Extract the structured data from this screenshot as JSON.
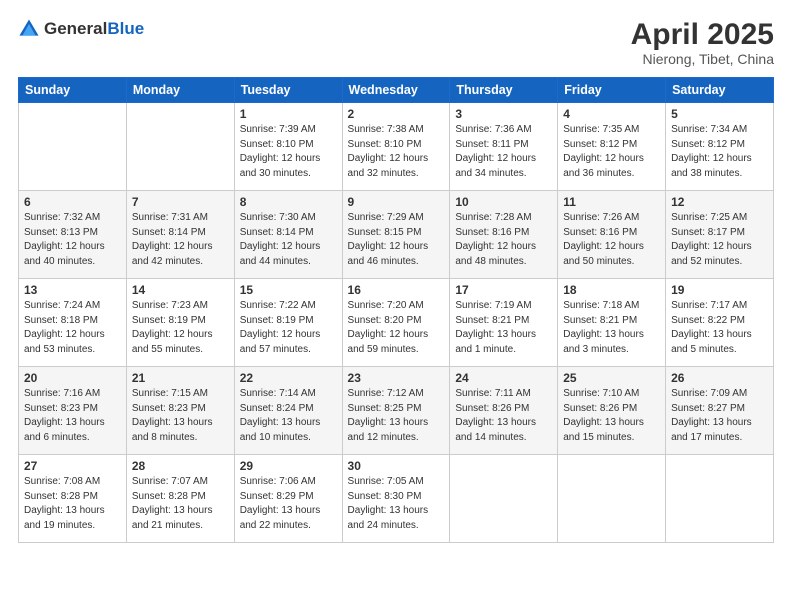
{
  "header": {
    "logo_general": "General",
    "logo_blue": "Blue",
    "month_year": "April 2025",
    "location": "Nierong, Tibet, China"
  },
  "days_of_week": [
    "Sunday",
    "Monday",
    "Tuesday",
    "Wednesday",
    "Thursday",
    "Friday",
    "Saturday"
  ],
  "weeks": [
    [
      {
        "day": "",
        "info": ""
      },
      {
        "day": "",
        "info": ""
      },
      {
        "day": "1",
        "info": "Sunrise: 7:39 AM\nSunset: 8:10 PM\nDaylight: 12 hours and 30 minutes."
      },
      {
        "day": "2",
        "info": "Sunrise: 7:38 AM\nSunset: 8:10 PM\nDaylight: 12 hours and 32 minutes."
      },
      {
        "day": "3",
        "info": "Sunrise: 7:36 AM\nSunset: 8:11 PM\nDaylight: 12 hours and 34 minutes."
      },
      {
        "day": "4",
        "info": "Sunrise: 7:35 AM\nSunset: 8:12 PM\nDaylight: 12 hours and 36 minutes."
      },
      {
        "day": "5",
        "info": "Sunrise: 7:34 AM\nSunset: 8:12 PM\nDaylight: 12 hours and 38 minutes."
      }
    ],
    [
      {
        "day": "6",
        "info": "Sunrise: 7:32 AM\nSunset: 8:13 PM\nDaylight: 12 hours and 40 minutes."
      },
      {
        "day": "7",
        "info": "Sunrise: 7:31 AM\nSunset: 8:14 PM\nDaylight: 12 hours and 42 minutes."
      },
      {
        "day": "8",
        "info": "Sunrise: 7:30 AM\nSunset: 8:14 PM\nDaylight: 12 hours and 44 minutes."
      },
      {
        "day": "9",
        "info": "Sunrise: 7:29 AM\nSunset: 8:15 PM\nDaylight: 12 hours and 46 minutes."
      },
      {
        "day": "10",
        "info": "Sunrise: 7:28 AM\nSunset: 8:16 PM\nDaylight: 12 hours and 48 minutes."
      },
      {
        "day": "11",
        "info": "Sunrise: 7:26 AM\nSunset: 8:16 PM\nDaylight: 12 hours and 50 minutes."
      },
      {
        "day": "12",
        "info": "Sunrise: 7:25 AM\nSunset: 8:17 PM\nDaylight: 12 hours and 52 minutes."
      }
    ],
    [
      {
        "day": "13",
        "info": "Sunrise: 7:24 AM\nSunset: 8:18 PM\nDaylight: 12 hours and 53 minutes."
      },
      {
        "day": "14",
        "info": "Sunrise: 7:23 AM\nSunset: 8:19 PM\nDaylight: 12 hours and 55 minutes."
      },
      {
        "day": "15",
        "info": "Sunrise: 7:22 AM\nSunset: 8:19 PM\nDaylight: 12 hours and 57 minutes."
      },
      {
        "day": "16",
        "info": "Sunrise: 7:20 AM\nSunset: 8:20 PM\nDaylight: 12 hours and 59 minutes."
      },
      {
        "day": "17",
        "info": "Sunrise: 7:19 AM\nSunset: 8:21 PM\nDaylight: 13 hours and 1 minute."
      },
      {
        "day": "18",
        "info": "Sunrise: 7:18 AM\nSunset: 8:21 PM\nDaylight: 13 hours and 3 minutes."
      },
      {
        "day": "19",
        "info": "Sunrise: 7:17 AM\nSunset: 8:22 PM\nDaylight: 13 hours and 5 minutes."
      }
    ],
    [
      {
        "day": "20",
        "info": "Sunrise: 7:16 AM\nSunset: 8:23 PM\nDaylight: 13 hours and 6 minutes."
      },
      {
        "day": "21",
        "info": "Sunrise: 7:15 AM\nSunset: 8:23 PM\nDaylight: 13 hours and 8 minutes."
      },
      {
        "day": "22",
        "info": "Sunrise: 7:14 AM\nSunset: 8:24 PM\nDaylight: 13 hours and 10 minutes."
      },
      {
        "day": "23",
        "info": "Sunrise: 7:12 AM\nSunset: 8:25 PM\nDaylight: 13 hours and 12 minutes."
      },
      {
        "day": "24",
        "info": "Sunrise: 7:11 AM\nSunset: 8:26 PM\nDaylight: 13 hours and 14 minutes."
      },
      {
        "day": "25",
        "info": "Sunrise: 7:10 AM\nSunset: 8:26 PM\nDaylight: 13 hours and 15 minutes."
      },
      {
        "day": "26",
        "info": "Sunrise: 7:09 AM\nSunset: 8:27 PM\nDaylight: 13 hours and 17 minutes."
      }
    ],
    [
      {
        "day": "27",
        "info": "Sunrise: 7:08 AM\nSunset: 8:28 PM\nDaylight: 13 hours and 19 minutes."
      },
      {
        "day": "28",
        "info": "Sunrise: 7:07 AM\nSunset: 8:28 PM\nDaylight: 13 hours and 21 minutes."
      },
      {
        "day": "29",
        "info": "Sunrise: 7:06 AM\nSunset: 8:29 PM\nDaylight: 13 hours and 22 minutes."
      },
      {
        "day": "30",
        "info": "Sunrise: 7:05 AM\nSunset: 8:30 PM\nDaylight: 13 hours and 24 minutes."
      },
      {
        "day": "",
        "info": ""
      },
      {
        "day": "",
        "info": ""
      },
      {
        "day": "",
        "info": ""
      }
    ]
  ]
}
